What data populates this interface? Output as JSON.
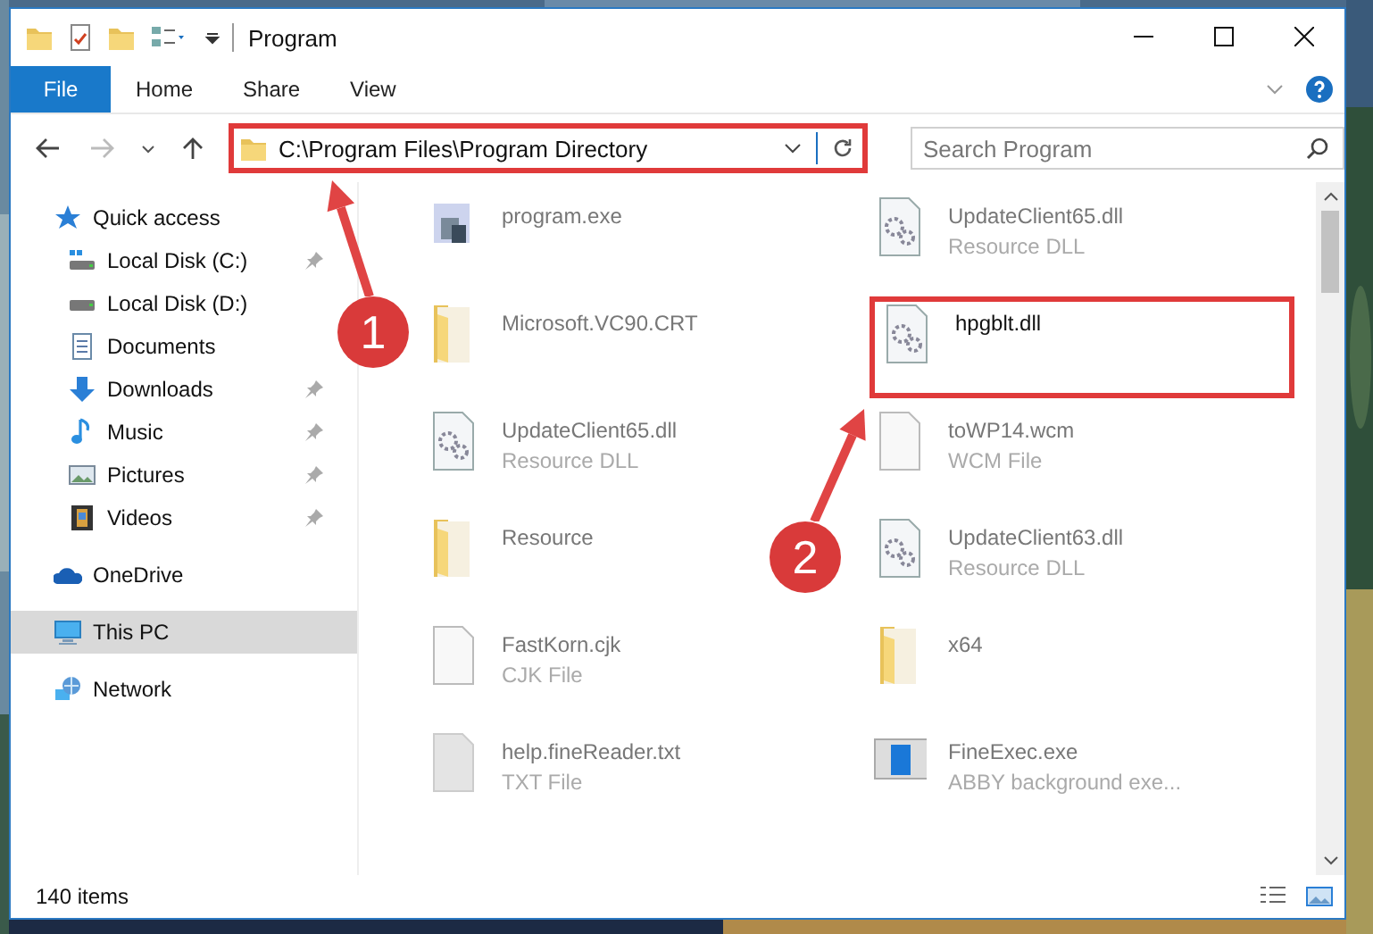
{
  "window": {
    "title": "Program"
  },
  "ribbon_tabs": [
    {
      "label": "File",
      "kind": "menu"
    },
    {
      "label": "Home",
      "kind": "tab"
    },
    {
      "label": "Share",
      "kind": "tab"
    },
    {
      "label": "View",
      "kind": "tab"
    }
  ],
  "address_bar": {
    "path": "C:\\Program Files\\Program Directory",
    "highlighted": true
  },
  "search": {
    "placeholder": "Search Program"
  },
  "nav": [
    {
      "label": "Quick access",
      "selected": false,
      "children": [
        {
          "label": "Local Disk (C:)",
          "pinned": true,
          "selected": false
        },
        {
          "label": "Local Disk (D:)",
          "pinned": false,
          "selected": false
        },
        {
          "label": "Documents",
          "pinned": false,
          "selected": false
        },
        {
          "label": "Downloads",
          "pinned": true,
          "selected": false
        },
        {
          "label": "Music",
          "pinned": true,
          "selected": false
        },
        {
          "label": "Pictures",
          "pinned": true,
          "selected": false
        },
        {
          "label": "Videos",
          "pinned": true,
          "selected": false
        }
      ]
    },
    {
      "label": "OneDrive",
      "selected": false
    },
    {
      "label": "This PC",
      "selected": true
    },
    {
      "label": "Network",
      "selected": false
    }
  ],
  "files": [
    {
      "name": "program.exe",
      "kind": "exe",
      "highlighted": false
    },
    {
      "name": "UpdateClient65.dll",
      "type": "Resource DLL",
      "kind": "dll",
      "highlighted": false
    },
    {
      "name": "Microsoft.VC90.CRT",
      "kind": "folder",
      "highlighted": false
    },
    {
      "name": "hpgblt.dll",
      "kind": "dll",
      "highlighted": true
    },
    {
      "name": "UpdateClient65.dll",
      "type": "Resource DLL",
      "kind": "dll",
      "highlighted": false
    },
    {
      "name": "toWP14.wcm",
      "type": "WCM File",
      "kind": "file",
      "highlighted": false
    },
    {
      "name": "Resource",
      "kind": "folder",
      "highlighted": false
    },
    {
      "name": "UpdateClient63.dll",
      "type": "Resource DLL",
      "kind": "dll",
      "highlighted": false
    },
    {
      "name": "FastKorn.cjk",
      "type": "CJK File",
      "kind": "file",
      "highlighted": false
    },
    {
      "name": "x64",
      "kind": "folder",
      "highlighted": false
    },
    {
      "name": "help.fineReader.txt",
      "type": "TXT File",
      "kind": "text",
      "highlighted": false
    },
    {
      "name": "FineExec.exe",
      "type": "ABBY background exe...",
      "kind": "app",
      "highlighted": false
    }
  ],
  "status_bar": {
    "item_count": "140 items"
  },
  "annotations": [
    {
      "number": "1"
    },
    {
      "number": "2"
    }
  ]
}
